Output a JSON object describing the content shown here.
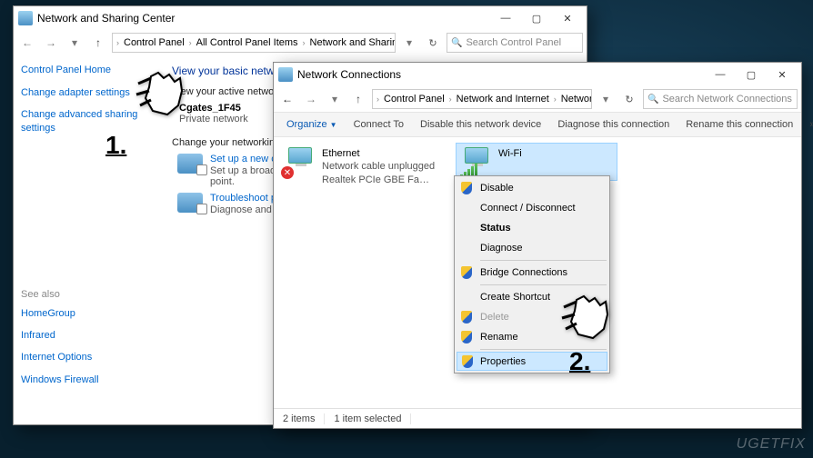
{
  "win1": {
    "title": "Network and Sharing Center",
    "breadcrumbs": [
      "Control Panel",
      "All Control Panel Items",
      "Network and Sharing Center"
    ],
    "search_placeholder": "Search Control Panel",
    "side": {
      "home": "Control Panel Home",
      "links": [
        "Change adapter settings",
        "Change advanced sharing settings"
      ],
      "see_also_label": "See also",
      "see_also": [
        "HomeGroup",
        "Infrared",
        "Internet Options",
        "Windows Firewall"
      ]
    },
    "main": {
      "heading": "View your basic network information and set up connections",
      "active_label": "View your active networks",
      "network": {
        "name": "Cgates_1F45",
        "type": "Private network"
      },
      "change_label": "Change your networking settings",
      "tasks": [
        {
          "link": "Set up a new connection or network",
          "desc": "Set up a broadband, dial-up, or VPN connection; or set up a router or access point."
        },
        {
          "link": "Troubleshoot problems",
          "desc": "Diagnose and repair network problems, or get troubleshooting information."
        }
      ]
    },
    "step": "1."
  },
  "win2": {
    "title": "Network Connections",
    "breadcrumbs": [
      "Control Panel",
      "Network and Internet",
      "Network Connections"
    ],
    "search_placeholder": "Search Network Connections",
    "toolbar": {
      "organize": "Organize",
      "buttons": [
        "Connect To",
        "Disable this network device",
        "Diagnose this connection",
        "Rename this connection"
      ]
    },
    "connections": [
      {
        "name": "Ethernet",
        "status": "Network cable unplugged",
        "adapter": "Realtek PCIe GBE Family Controller",
        "selected": false,
        "disconnected": true
      },
      {
        "name": "Wi-Fi",
        "status": "",
        "adapter": "",
        "selected": true,
        "disconnected": false
      }
    ],
    "context_menu": [
      {
        "label": "Disable",
        "shield": true
      },
      {
        "label": "Connect / Disconnect"
      },
      {
        "label": "Status",
        "bold": true
      },
      {
        "label": "Diagnose"
      },
      {
        "sep": true
      },
      {
        "label": "Bridge Connections",
        "shield": true
      },
      {
        "sep": true
      },
      {
        "label": "Create Shortcut"
      },
      {
        "label": "Delete",
        "shield": true,
        "disabled": true
      },
      {
        "label": "Rename",
        "shield": true
      },
      {
        "sep": true
      },
      {
        "label": "Properties",
        "shield": true,
        "highlight": true
      }
    ],
    "status_bar": {
      "items": "2 items",
      "selected": "1 item selected"
    },
    "step": "2."
  },
  "watermark": "UGETFIX"
}
